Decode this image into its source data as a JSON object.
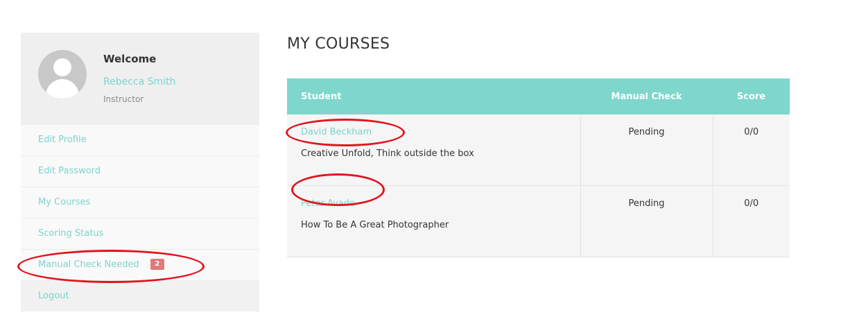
{
  "profile": {
    "welcome": "Welcome",
    "name": "Rebecca Smith",
    "role": "Instructor",
    "avatar_icon": "user-avatar-icon"
  },
  "sidebar": {
    "items": [
      {
        "label": "Edit Profile"
      },
      {
        "label": "Edit Password"
      },
      {
        "label": "My Courses"
      },
      {
        "label": "Scoring Status"
      },
      {
        "label": "Manual Check Needed",
        "badge": "2"
      },
      {
        "label": "Logout"
      }
    ]
  },
  "main": {
    "title": "MY COURSES",
    "table": {
      "headers": {
        "student": "Student",
        "manual_check": "Manual Check",
        "score": "Score"
      },
      "rows": [
        {
          "student": "David Beckham",
          "course": "Creative Unfold, Think outside the box",
          "manual_check": "Pending",
          "score": "0/0"
        },
        {
          "student": "Peter Avado",
          "course": "How To Be A Great Photographer",
          "manual_check": "Pending",
          "score": "0/0"
        }
      ]
    }
  },
  "colors": {
    "accent": "#7fd6cc",
    "link": "#7dd3cb",
    "badge": "#e27a7a",
    "annotation": "#e0151f"
  }
}
